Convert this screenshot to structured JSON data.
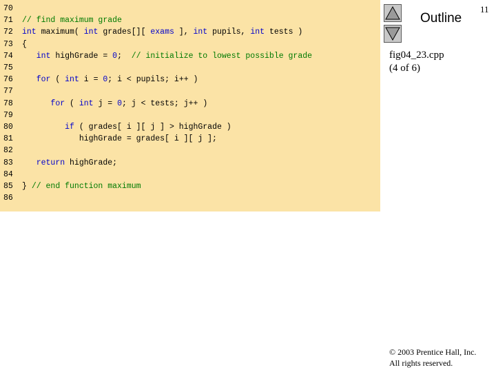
{
  "slide": {
    "outline_label": "Outline",
    "page_number": "11",
    "file_name": "fig04_23.cpp",
    "file_part": "(4 of 6)",
    "copyright_line1": "© 2003 Prentice Hall, Inc.",
    "copyright_line2": "All rights reserved.",
    "nav_up_icon": "triangle-up-icon",
    "nav_down_icon": "triangle-down-icon"
  },
  "colors": {
    "code_background": "#fbe3a6",
    "comment": "#007a00",
    "keyword": "#0000cc"
  },
  "code": {
    "lines": [
      {
        "num": "70",
        "tokens": []
      },
      {
        "num": "71",
        "tokens": [
          {
            "t": "// find maximum grade",
            "c": "comment"
          }
        ]
      },
      {
        "num": "72",
        "tokens": [
          {
            "t": "int",
            "c": "keyword"
          },
          {
            "t": " maximum( ",
            "c": "plain"
          },
          {
            "t": "int",
            "c": "keyword"
          },
          {
            "t": " grades[][ ",
            "c": "plain"
          },
          {
            "t": "exams",
            "c": "keyword"
          },
          {
            "t": " ], ",
            "c": "plain"
          },
          {
            "t": "int",
            "c": "keyword"
          },
          {
            "t": " pupils, ",
            "c": "plain"
          },
          {
            "t": "int",
            "c": "keyword"
          },
          {
            "t": " tests )",
            "c": "plain"
          }
        ]
      },
      {
        "num": "73",
        "tokens": [
          {
            "t": "{",
            "c": "plain"
          }
        ]
      },
      {
        "num": "74",
        "tokens": [
          {
            "t": "   ",
            "c": "plain"
          },
          {
            "t": "int",
            "c": "keyword"
          },
          {
            "t": " highGrade = ",
            "c": "plain"
          },
          {
            "t": "0",
            "c": "keyword"
          },
          {
            "t": ";  ",
            "c": "plain"
          },
          {
            "t": "// initialize to lowest possible grade",
            "c": "comment"
          }
        ]
      },
      {
        "num": "75",
        "tokens": []
      },
      {
        "num": "76",
        "tokens": [
          {
            "t": "   ",
            "c": "plain"
          },
          {
            "t": "for",
            "c": "keyword"
          },
          {
            "t": " ( ",
            "c": "plain"
          },
          {
            "t": "int",
            "c": "keyword"
          },
          {
            "t": " i = ",
            "c": "plain"
          },
          {
            "t": "0",
            "c": "keyword"
          },
          {
            "t": "; i < pupils; i++ )",
            "c": "plain"
          }
        ]
      },
      {
        "num": "77",
        "tokens": []
      },
      {
        "num": "78",
        "tokens": [
          {
            "t": "      ",
            "c": "plain"
          },
          {
            "t": "for",
            "c": "keyword"
          },
          {
            "t": " ( ",
            "c": "plain"
          },
          {
            "t": "int",
            "c": "keyword"
          },
          {
            "t": " j = ",
            "c": "plain"
          },
          {
            "t": "0",
            "c": "keyword"
          },
          {
            "t": "; j < tests; j++ )",
            "c": "plain"
          }
        ]
      },
      {
        "num": "79",
        "tokens": []
      },
      {
        "num": "80",
        "tokens": [
          {
            "t": "         ",
            "c": "plain"
          },
          {
            "t": "if",
            "c": "keyword"
          },
          {
            "t": " ( grades[ i ][ j ] > highGrade )",
            "c": "plain"
          }
        ]
      },
      {
        "num": "81",
        "tokens": [
          {
            "t": "            highGrade = grades[ i ][ j ];",
            "c": "plain"
          }
        ]
      },
      {
        "num": "82",
        "tokens": []
      },
      {
        "num": "83",
        "tokens": [
          {
            "t": "   ",
            "c": "plain"
          },
          {
            "t": "return",
            "c": "keyword"
          },
          {
            "t": " highGrade;",
            "c": "plain"
          }
        ]
      },
      {
        "num": "84",
        "tokens": []
      },
      {
        "num": "85",
        "tokens": [
          {
            "t": "} ",
            "c": "plain"
          },
          {
            "t": "// end function maximum",
            "c": "comment"
          }
        ]
      },
      {
        "num": "86",
        "tokens": []
      }
    ]
  }
}
